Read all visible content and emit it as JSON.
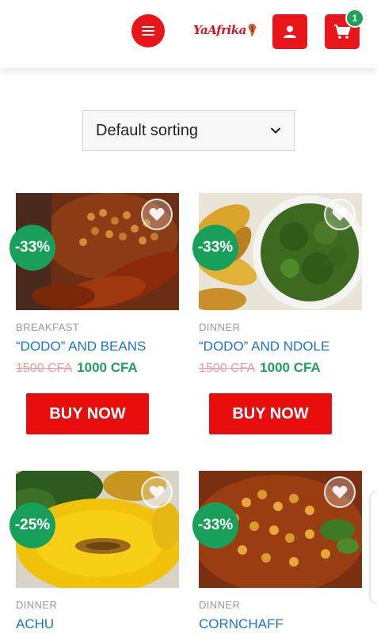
{
  "header": {
    "logo_text": "YaAfrika",
    "cart_count": "1",
    "icons": {
      "menu": "hamburger-icon",
      "account": "user-icon",
      "cart": "cart-icon"
    },
    "accent_color": "#e8161a"
  },
  "sorting": {
    "selected": "Default sorting"
  },
  "products": [
    {
      "badge": "-33%",
      "category": "BREAKFAST",
      "title": "“DODO” AND BEANS",
      "old_price": "1500 CFA",
      "new_price": "1000 CFA",
      "button": "BUY NOW"
    },
    {
      "badge": "-33%",
      "category": "DINNER",
      "title": "“DODO” AND NDOLE",
      "old_price": "1500 CFA",
      "new_price": "1000 CFA",
      "button": "BUY NOW"
    },
    {
      "badge": "-25%",
      "category": "DINNER",
      "title": "ACHU"
    },
    {
      "badge": "-33%",
      "category": "DINNER",
      "title": "CORNCHAFF"
    }
  ],
  "colors": {
    "sale_badge": "#18a05a",
    "buy_button": "#e80e0e",
    "title_link": "#1e74c9",
    "new_price": "#1ea15a",
    "old_price": "#f29a9a"
  }
}
